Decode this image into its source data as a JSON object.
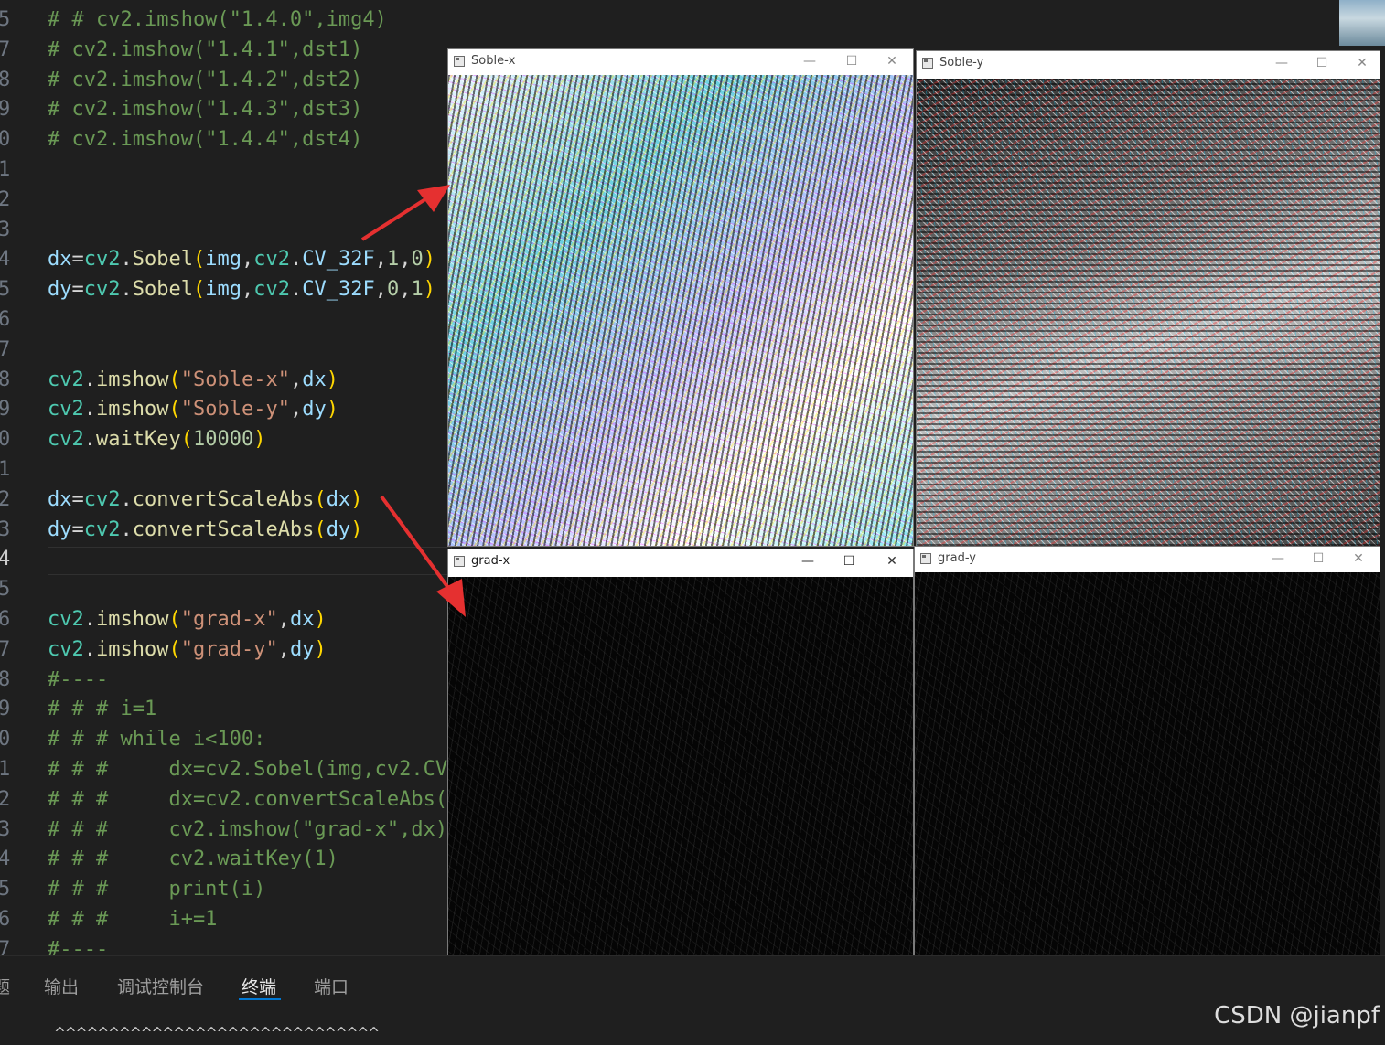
{
  "editor": {
    "gutter": [
      "5",
      "7",
      "8",
      "9",
      "0",
      "1",
      "2",
      "3",
      "4",
      "5",
      "6",
      "7",
      "8",
      "9",
      "0",
      "1",
      "2",
      "3",
      "4",
      "5",
      "6",
      "7",
      "8",
      "9",
      "0",
      "1",
      "2",
      "3",
      "4",
      "5",
      "6",
      "7"
    ],
    "lines": [
      "# # cv2.imshow(\"1.4.0\",img4)",
      "# cv2.imshow(\"1.4.1\",dst1)",
      "# cv2.imshow(\"1.4.2\",dst2)",
      "# cv2.imshow(\"1.4.3\",dst3)",
      "# cv2.imshow(\"1.4.4\",dst4)",
      "",
      "",
      "",
      "dx=cv2.Sobel(img,cv2.CV_32F,1,0)",
      "dy=cv2.Sobel(img,cv2.CV_32F,0,1)",
      "",
      "",
      "cv2.imshow(\"Soble-x\",dx)",
      "cv2.imshow(\"Soble-y\",dy)",
      "cv2.waitKey(10000)",
      "",
      "dx=cv2.convertScaleAbs(dx)",
      "dy=cv2.convertScaleAbs(dy)",
      "",
      "",
      "cv2.imshow(\"grad-x\",dx)",
      "cv2.imshow(\"grad-y\",dy)",
      "#----",
      "# # # i=1",
      "# # # while i<100:",
      "# # #     dx=cv2.Sobel(img,cv2.CV",
      "# # #     dx=cv2.convertScaleAbs(",
      "# # #     cv2.imshow(\"grad-x\",dx)",
      "# # #     cv2.waitKey(1)",
      "# # #     print(i)",
      "# # #     i+=1",
      "#----"
    ]
  },
  "panel": {
    "tabs": [
      "题",
      "输出",
      "调试控制台",
      "终端",
      "端口"
    ],
    "active_tab": "终端",
    "terminal_text": "^^^^^^^^^^^^^^^^^^^^^^^^^^^^^^"
  },
  "windows": {
    "soble_x": {
      "title": "Soble-x"
    },
    "soble_y": {
      "title": "Soble-y"
    },
    "grad_x": {
      "title": "grad-x"
    },
    "grad_y": {
      "title": "grad-y"
    }
  },
  "window_controls": {
    "minimize": "—",
    "maximize": "☐",
    "close": "✕"
  },
  "watermark": "CSDN @jianpf",
  "colors": {
    "editor_bg": "#1f1f1f",
    "comment": "#6a9955",
    "arrow": "#e53030"
  }
}
